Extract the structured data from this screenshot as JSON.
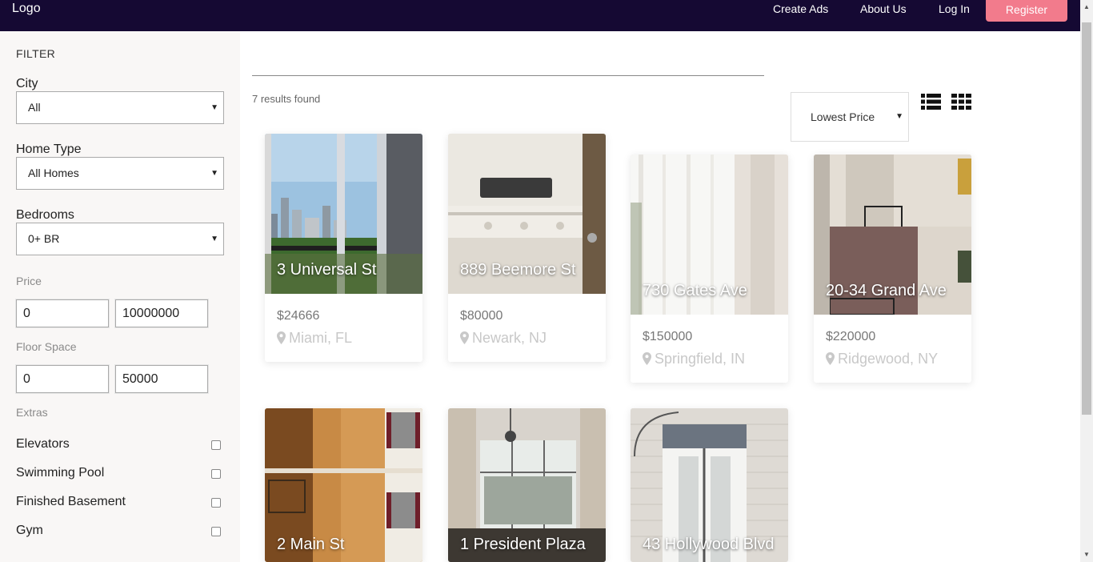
{
  "header": {
    "logo": "Logo",
    "nav": [
      "Create Ads",
      "About Us",
      "Log In"
    ],
    "register_label": "Register",
    "bg_color": "#150933",
    "accent_color": "#f27b8c"
  },
  "filter": {
    "title": "FILTER",
    "city": {
      "label": "City",
      "value": "All"
    },
    "home_type": {
      "label": "Home Type",
      "value": "All Homes"
    },
    "bedrooms": {
      "label": "Bedrooms",
      "value": "0+ BR"
    },
    "price": {
      "label": "Price",
      "min": "0",
      "max": "10000000"
    },
    "floor_space": {
      "label": "Floor Space",
      "min": "0",
      "max": "50000"
    },
    "extras": {
      "label": "Extras",
      "items": [
        "Elevators",
        "Swimming Pool",
        "Finished Basement",
        "Gym"
      ]
    }
  },
  "results": {
    "count_text": "7 results found",
    "sort_value": "Lowest Price"
  },
  "listings": [
    {
      "address": "3 Universal St",
      "price": "$24666",
      "location": "Miami, FL"
    },
    {
      "address": "889 Beemore St",
      "price": "$80000",
      "location": "Newark, NJ"
    },
    {
      "address": "730 Gates Ave",
      "price": "$150000",
      "location": "Springfield, IN"
    },
    {
      "address": "20-34 Grand Ave",
      "price": "$220000",
      "location": "Ridgewood, NY"
    },
    {
      "address": "2 Main St"
    },
    {
      "address": "1 President Plaza"
    },
    {
      "address": "43 Hollywood Blvd"
    }
  ]
}
